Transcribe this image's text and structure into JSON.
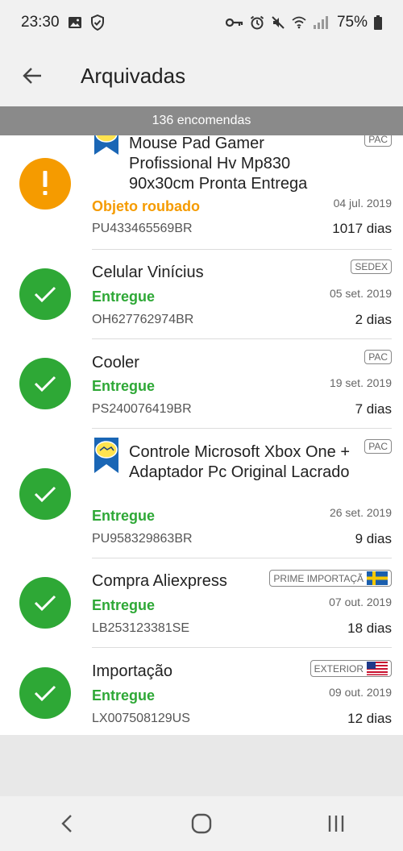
{
  "status_bar": {
    "time": "23:30",
    "battery": "75%",
    "icons": [
      "gallery-icon",
      "shield-check-icon",
      "key-icon",
      "alarm-icon",
      "mute-icon",
      "wifi-icon",
      "signal-icon",
      "battery-icon"
    ]
  },
  "header": {
    "title": "Arquivadas"
  },
  "count_label": "136 encomendas",
  "packages": [
    {
      "title": "Mouse Pad Gamer Profissional Hv Mp830 90x30cm Pronta Entrega",
      "status": "Objeto roubado",
      "status_kind": "alert",
      "code": "PU433465569BR",
      "date": "04 jul. 2019",
      "days": "1017 dias",
      "carrier": "PAC",
      "has_logo": true
    },
    {
      "title": "Celular Vinícius",
      "status": "Entregue",
      "status_kind": "ok",
      "code": "OH627762974BR",
      "date": "05 set. 2019",
      "days": "2 dias",
      "carrier": "SEDEX",
      "has_logo": false
    },
    {
      "title": "Cooler",
      "status": "Entregue",
      "status_kind": "ok",
      "code": "PS240076419BR",
      "date": "19 set. 2019",
      "days": "7 dias",
      "carrier": "PAC",
      "has_logo": false
    },
    {
      "title": "Controle Microsoft Xbox One +  Adaptador Pc Original Lacrado",
      "status": "Entregue",
      "status_kind": "ok",
      "code": "PU958329863BR",
      "date": "26 set. 2019",
      "days": "9 dias",
      "carrier": "PAC",
      "has_logo": true
    },
    {
      "title": "Compra Aliexpress",
      "status": "Entregue",
      "status_kind": "ok",
      "code": "LB253123381SE",
      "date": "07 out. 2019",
      "days": "18 dias",
      "carrier": "PRIME IMPORTAÇÃ",
      "flag": "sweden",
      "has_logo": false
    },
    {
      "title": "Importação",
      "status": "Entregue",
      "status_kind": "ok",
      "code": "LX007508129US",
      "date": "09 out. 2019",
      "days": "12 dias",
      "carrier": "EXTERIOR",
      "flag": "usa",
      "has_logo": false
    }
  ],
  "colors": {
    "green": "#2ea836",
    "orange": "#f59b00",
    "count_bar": "#8a8a8a"
  },
  "nav": {
    "back": "nav-back-icon",
    "home": "nav-home-icon",
    "recents": "nav-recents-icon"
  }
}
